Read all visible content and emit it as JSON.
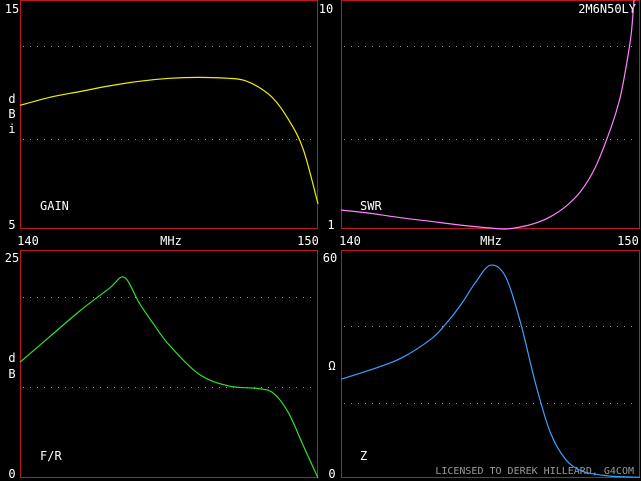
{
  "design_name": "2M6N50LY",
  "license_text": "LICENSED TO DEREK HILLEARD, G4COM",
  "colors": {
    "frame": "#c01818",
    "grid": "#9a9a9a",
    "text": "#ffffff",
    "gain": "#f0f000",
    "swr": "#ff80ff",
    "fr": "#30e030",
    "z": "#3ca0ff"
  },
  "chart_data": [
    {
      "id": "gain",
      "type": "line",
      "series_label": "GAIN",
      "ylabel": "dBi",
      "ylabel_chars": [
        "d",
        "B",
        "i"
      ],
      "ylim": [
        5,
        15
      ],
      "ytick_labels": {
        "top": "15",
        "bottom": "5"
      },
      "xlim": [
        140,
        150
      ],
      "xtick_labels": {
        "left": "140",
        "center": "MHz",
        "right": "150"
      },
      "grid": true,
      "x": [
        140,
        141,
        142,
        143,
        144,
        145,
        146,
        147,
        147.5,
        148,
        148.5,
        149,
        149.5,
        150
      ],
      "y": [
        10.4,
        10.75,
        11.0,
        11.25,
        11.45,
        11.58,
        11.62,
        11.58,
        11.5,
        11.2,
        10.7,
        9.8,
        8.5,
        6.1
      ]
    },
    {
      "id": "swr",
      "type": "line",
      "series_label": "SWR",
      "ylim": [
        1,
        10
      ],
      "yscale": "log",
      "ytick_labels": {
        "top": "10",
        "bottom": "1"
      },
      "xlim": [
        140,
        150
      ],
      "xtick_labels": {
        "left": "140",
        "center": "MHz",
        "right": "150"
      },
      "grid": true,
      "x": [
        140,
        141,
        142,
        143,
        144,
        145,
        145.5,
        146,
        146.5,
        147,
        147.5,
        148,
        148.5,
        149,
        149.3,
        149.5,
        149.7,
        149.8
      ],
      "y": [
        1.21,
        1.17,
        1.12,
        1.08,
        1.04,
        1.01,
        1.0,
        1.02,
        1.06,
        1.13,
        1.25,
        1.45,
        1.85,
        2.7,
        3.6,
        4.8,
        7.0,
        10.0
      ]
    },
    {
      "id": "fr",
      "type": "line",
      "series_label": "F/R",
      "ylabel": "dB",
      "ylabel_chars": [
        "d",
        "B"
      ],
      "ylim": [
        0,
        25
      ],
      "ytick_labels": {
        "top": "25",
        "bottom": "0"
      },
      "xlim": [
        140,
        150
      ],
      "grid": true,
      "x": [
        140,
        141,
        142,
        143,
        143.5,
        144,
        144.5,
        145,
        146,
        147,
        148,
        148.5,
        149,
        149.5,
        150
      ],
      "y": [
        12.7,
        15.5,
        18.3,
        20.8,
        22.0,
        19.2,
        16.8,
        14.6,
        11.4,
        10.1,
        9.8,
        9.3,
        7.2,
        3.6,
        0
      ]
    },
    {
      "id": "z",
      "type": "line",
      "series_label": "Z",
      "ylabel": "Ω",
      "ylabel_chars": [
        "Ω"
      ],
      "ylim": [
        0,
        60
      ],
      "ytick_labels": {
        "top": "60",
        "bottom": "0"
      },
      "xlim": [
        140,
        150
      ],
      "grid": true,
      "x": [
        140,
        141,
        142,
        143,
        143.5,
        144,
        144.5,
        145,
        145.5,
        146,
        146.5,
        147,
        147.5,
        148,
        148.5,
        149,
        149.5,
        150
      ],
      "y": [
        26.0,
        28.5,
        31.5,
        36.5,
        40.5,
        45.5,
        51.5,
        56.0,
        53.0,
        41.0,
        25.0,
        12.0,
        5.0,
        2.0,
        1.0,
        0.5,
        0.3,
        0.2
      ]
    }
  ]
}
